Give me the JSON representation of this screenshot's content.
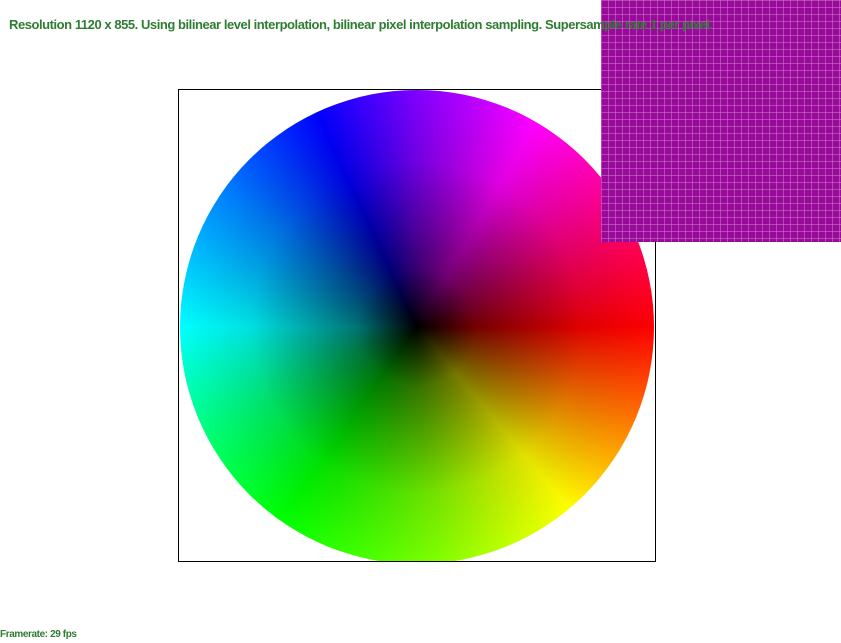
{
  "status": {
    "text": "Resolution 1120 x 855. Using bilinear level interpolation, bilinear pixel interpolation sampling. Supersample rate 1 per pixel."
  },
  "framerate": {
    "text": "Framerate: 29 fps"
  },
  "zoom_inset": {
    "color": "#9a0a9a"
  },
  "colors": {
    "status_text": "#2e7d32",
    "border": "#000000",
    "background": "#ffffff"
  }
}
